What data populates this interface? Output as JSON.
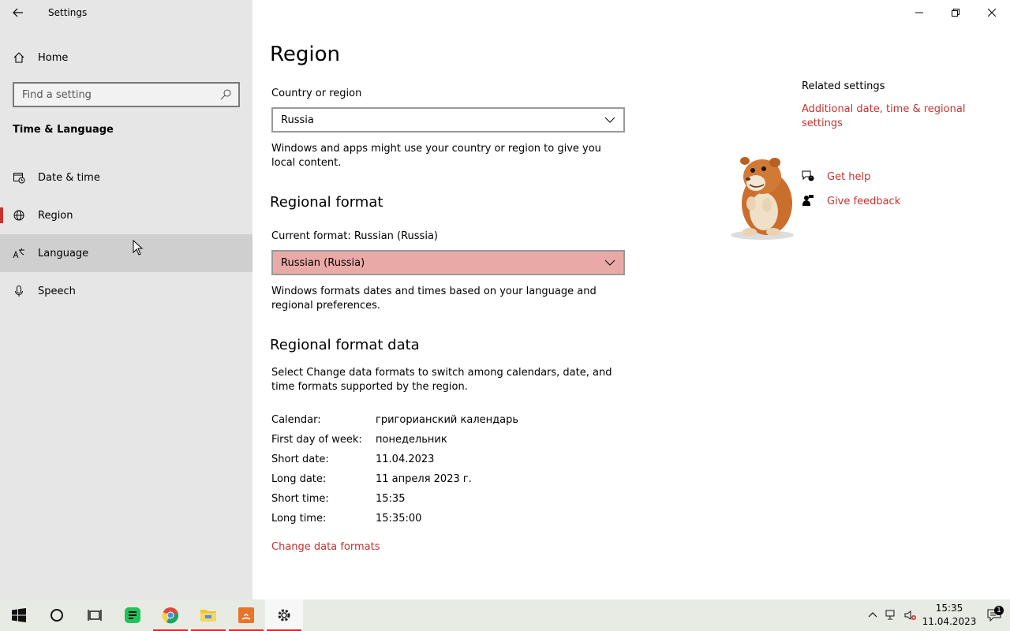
{
  "window": {
    "title": "Settings"
  },
  "sidebar": {
    "home_label": "Home",
    "search_placeholder": "Find a setting",
    "section": "Time & Language",
    "items": [
      {
        "label": "Date & time",
        "icon": "calendar-clock-icon"
      },
      {
        "label": "Region",
        "icon": "globe-icon",
        "selected": true
      },
      {
        "label": "Language",
        "icon": "language-icon",
        "hovered": true
      },
      {
        "label": "Speech",
        "icon": "microphone-icon"
      }
    ]
  },
  "main": {
    "title": "Region",
    "country_label": "Country or region",
    "country_value": "Russia",
    "country_desc": "Windows and apps might use your country or region to give you local content.",
    "regional_format_heading": "Regional format",
    "current_format_label": "Current format: Russian (Russia)",
    "format_value": "Russian (Russia)",
    "format_desc": "Windows formats dates and times based on your language and regional preferences.",
    "format_data_heading": "Regional format data",
    "format_data_desc": "Select Change data formats to switch among calendars, date, and time formats supported by the region.",
    "format_rows": [
      {
        "key": "Calendar:",
        "value": "григорианский календарь"
      },
      {
        "key": "First day of week:",
        "value": "понедельник"
      },
      {
        "key": "Short date:",
        "value": "11.04.2023"
      },
      {
        "key": "Long date:",
        "value": "11 апреля 2023 г."
      },
      {
        "key": "Short time:",
        "value": "15:35"
      },
      {
        "key": "Long time:",
        "value": "15:35:00"
      }
    ],
    "change_formats_link": "Change data formats"
  },
  "related": {
    "heading": "Related settings",
    "additional_link": "Additional date, time & regional settings",
    "get_help": "Get help",
    "give_feedback": "Give feedback"
  },
  "taskbar": {
    "time": "15:35",
    "date": "11.04.2023",
    "notification_count": "1"
  },
  "colors": {
    "accent": "#c8322e",
    "sidebar_bg": "#e6e6e6",
    "format_dropdown_bg": "#e9aaa7"
  }
}
